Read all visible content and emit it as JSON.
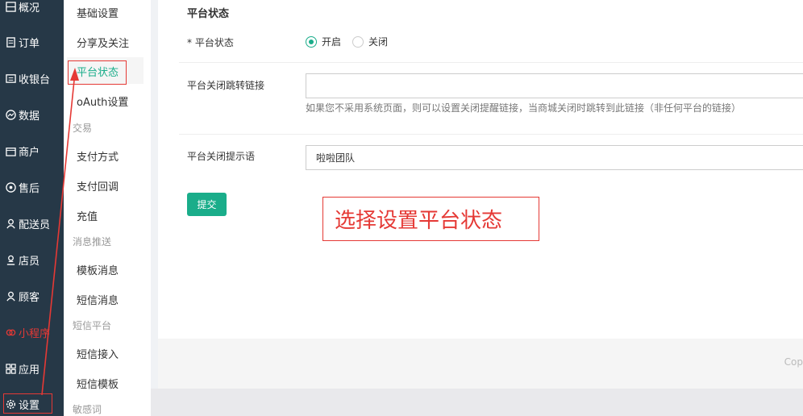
{
  "nav": {
    "items": [
      {
        "label": "概况",
        "icon": "overview-icon"
      },
      {
        "label": "订单",
        "icon": "order-icon"
      },
      {
        "label": "收银台",
        "icon": "cashier-icon"
      },
      {
        "label": "数据",
        "icon": "data-icon"
      },
      {
        "label": "商户",
        "icon": "merchant-icon"
      },
      {
        "label": "售后",
        "icon": "aftersale-icon"
      },
      {
        "label": "配送员",
        "icon": "courier-icon"
      },
      {
        "label": "店员",
        "icon": "clerk-icon"
      },
      {
        "label": "顾客",
        "icon": "customer-icon"
      },
      {
        "label": "小程序",
        "icon": "miniprogram-icon"
      },
      {
        "label": "应用",
        "icon": "apps-icon"
      },
      {
        "label": "设置",
        "icon": "gear-icon"
      }
    ]
  },
  "subnav": {
    "items": [
      "基础设置",
      "分享及关注",
      "平台状态",
      "oAuth设置",
      "支付方式",
      "支付回调",
      "充值",
      "模板消息",
      "短信消息",
      "短信接入",
      "短信模板"
    ],
    "groups": [
      "交易",
      "消息推送",
      "短信平台",
      "敏感词"
    ]
  },
  "form": {
    "section_title": "平台状态",
    "status_label": "* 平台状态",
    "radio_open": "开启",
    "radio_close": "关闭",
    "redirect_label": "平台关闭跳转链接",
    "redirect_value": "",
    "redirect_hint": "如果您不采用系统页面，则可以设置关闭提醒链接，当商城关闭时跳转到此链接（非任何平台的链接）",
    "tip_label": "平台关闭提示语",
    "tip_value": "啦啦团队",
    "submit_label": "提交"
  },
  "annotation": {
    "text": "选择设置平台状态"
  },
  "footer": {
    "copyright": "Cop"
  },
  "colors": {
    "nav_bg": "#263847",
    "accent": "#1aad8a",
    "annotation_red": "#e53935"
  }
}
